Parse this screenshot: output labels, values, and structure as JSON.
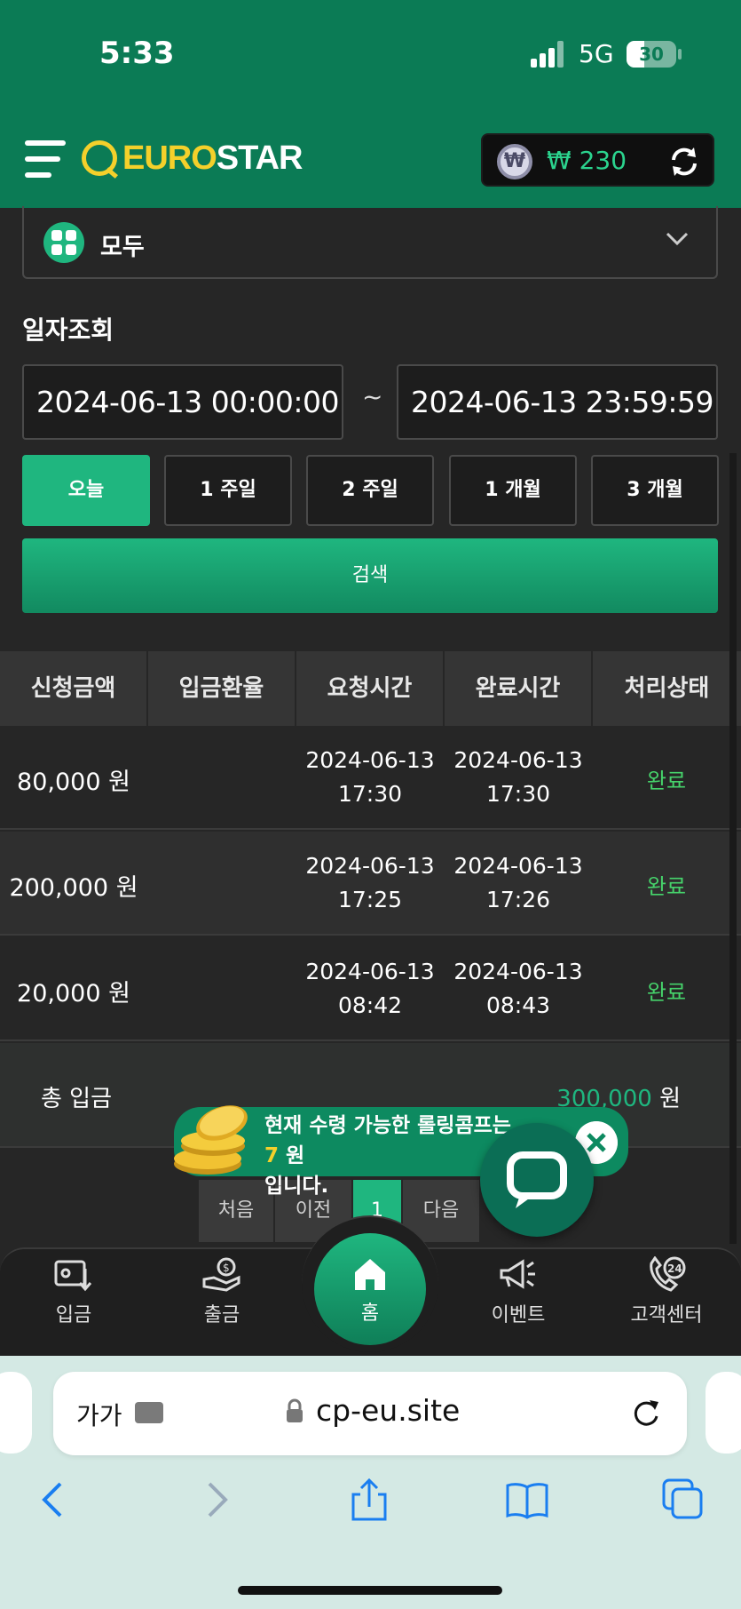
{
  "status_bar": {
    "time": "5:33",
    "network": "5G",
    "battery": "30"
  },
  "header": {
    "logo_euro": "EURO",
    "logo_star": "STAR",
    "wallet_amount": "₩ 230",
    "wallet_coin_symbol": "₩"
  },
  "filter": {
    "category": "모두",
    "date_title": "일자조회",
    "date_from": "2024-06-13 00:00:00",
    "date_separator": "~",
    "date_to": "2024-06-13 23:59:59",
    "periods": [
      "오늘",
      "1 주일",
      "2 주일",
      "1 개월",
      "3 개월"
    ],
    "active_period_index": 0,
    "search_label": "검색"
  },
  "table": {
    "headers": [
      "신청금액",
      "입금환율",
      "요청시간",
      "완료시간",
      "처리상태"
    ],
    "rows": [
      {
        "amount": "80,000 원",
        "rate": "",
        "request_date": "2024-06-13",
        "request_time": "17:30",
        "complete_date": "2024-06-13",
        "complete_time": "17:30",
        "status": "완료"
      },
      {
        "amount": "200,000 원",
        "rate": "",
        "request_date": "2024-06-13",
        "request_time": "17:25",
        "complete_date": "2024-06-13",
        "complete_time": "17:26",
        "status": "완료"
      },
      {
        "amount": "20,000 원",
        "rate": "",
        "request_date": "2024-06-13",
        "request_time": "08:42",
        "complete_date": "2024-06-13",
        "complete_time": "08:43",
        "status": "완료"
      }
    ],
    "total_label": "총 입금",
    "total_value": "300,000",
    "total_unit": " 원"
  },
  "pagination": {
    "first": "처음",
    "prev": "이전",
    "current": "1",
    "next": "다음"
  },
  "toast": {
    "text_before": "현재 수령 가능한 롤링콤프는 ",
    "highlight": "7",
    "text_mid": " 원",
    "text_after": "입니다."
  },
  "bottom_nav": {
    "deposit": "입금",
    "withdraw": "출금",
    "home": "홈",
    "event": "이벤트",
    "support": "고객센터"
  },
  "browser": {
    "text_size": "가가",
    "url": "cp-eu.site"
  },
  "colors": {
    "brand_green": "#0b7b55",
    "accent": "#1fb67f",
    "logo_yellow": "#f4d02b",
    "status_done": "#46d36b"
  }
}
